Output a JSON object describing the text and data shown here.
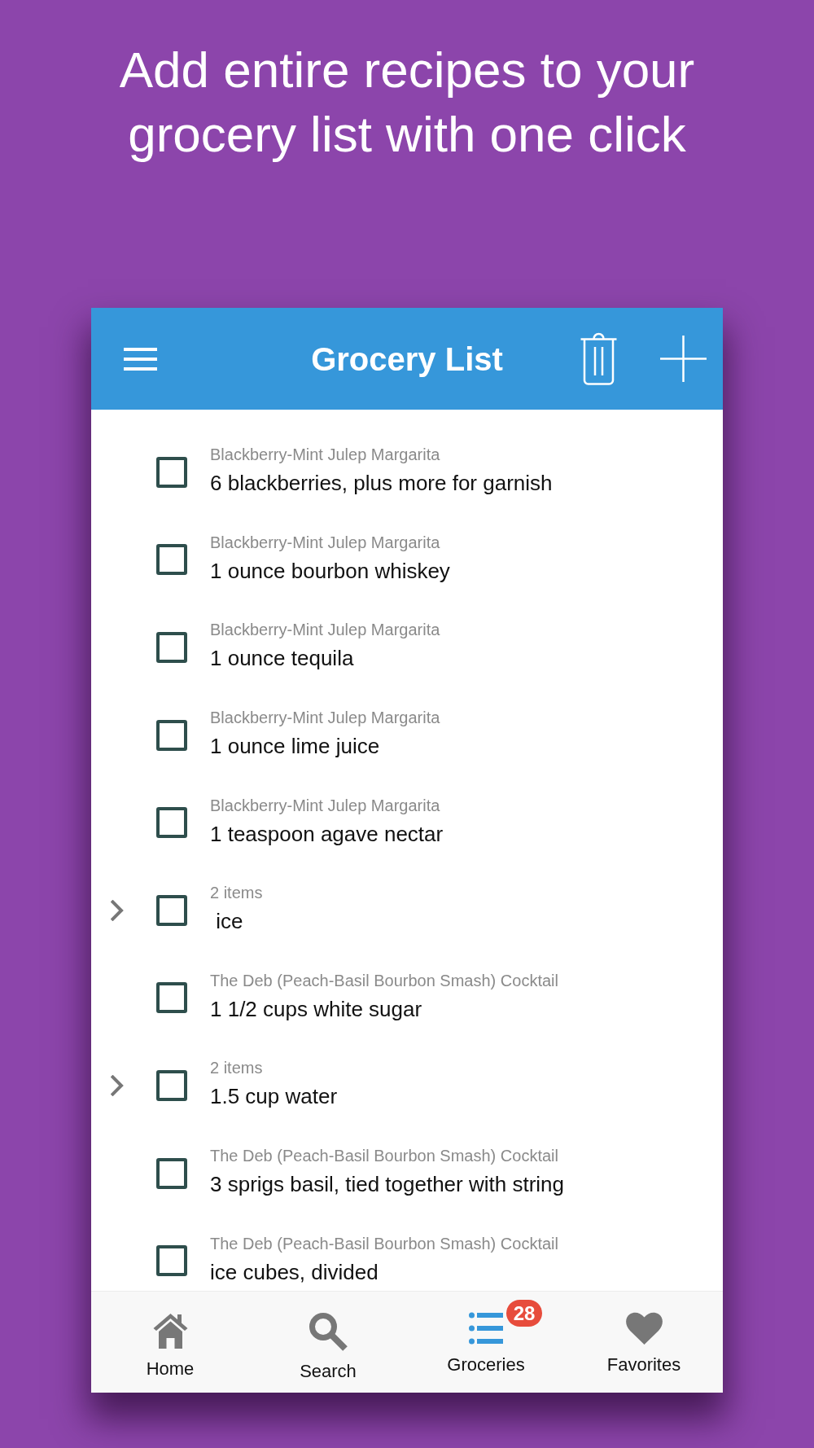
{
  "headline": "Add entire recipes to your grocery list with one click",
  "app_bar": {
    "title": "Grocery List"
  },
  "items": [
    {
      "kind": "item",
      "caption": "Blackberry-Mint Julep Margarita",
      "text": "6 blackberries, plus more for garnish",
      "checked": false
    },
    {
      "kind": "item",
      "caption": "Blackberry-Mint Julep Margarita",
      "text": "1 ounce bourbon whiskey",
      "checked": false
    },
    {
      "kind": "item",
      "caption": "Blackberry-Mint Julep Margarita",
      "text": "1 ounce tequila",
      "checked": false
    },
    {
      "kind": "item",
      "caption": "Blackberry-Mint Julep Margarita",
      "text": "1 ounce lime juice",
      "checked": false
    },
    {
      "kind": "item",
      "caption": "Blackberry-Mint Julep Margarita",
      "text": "1 teaspoon agave nectar",
      "checked": false
    },
    {
      "kind": "group",
      "caption": "2 items",
      "text": " ice",
      "checked": false
    },
    {
      "kind": "item",
      "caption": "The Deb (Peach-Basil Bourbon Smash) Cocktail",
      "text": "1 1/2 cups white sugar",
      "checked": false
    },
    {
      "kind": "group",
      "caption": "2 items",
      "text": "1.5 cup water",
      "checked": false
    },
    {
      "kind": "item",
      "caption": "The Deb (Peach-Basil Bourbon Smash) Cocktail",
      "text": "3 sprigs basil, tied together with string",
      "checked": false
    },
    {
      "kind": "item",
      "caption": "The Deb (Peach-Basil Bourbon Smash) Cocktail",
      "text": "ice cubes, divided",
      "checked": false
    }
  ],
  "bottom_nav": [
    {
      "label": "Home",
      "selected": false
    },
    {
      "label": "Search",
      "selected": false
    },
    {
      "label": "Groceries",
      "selected": true,
      "badge": "28"
    },
    {
      "label": "Favorites",
      "selected": false
    }
  ]
}
